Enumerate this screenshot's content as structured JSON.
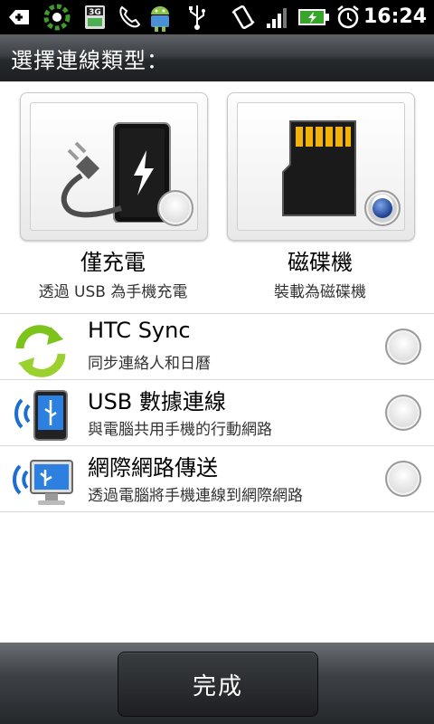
{
  "status_bar": {
    "time": "16:24",
    "network_type": "3G",
    "icons": [
      "add-icon",
      "loading-icon",
      "sim-3g-icon",
      "phone-icon",
      "android-icon",
      "usb-icon",
      "vibrate-icon",
      "signal-icon",
      "battery-charging-icon",
      "alarm-icon"
    ]
  },
  "title": "選擇連線類型：",
  "options": [
    {
      "label": "僅充電",
      "description": "透過 USB 為手機充電",
      "icon": "charger-phone-icon",
      "selected": false
    },
    {
      "label": "磁碟機",
      "description": "裝載為磁碟機",
      "icon": "sd-card-icon",
      "selected": true
    }
  ],
  "list": [
    {
      "title": "HTC Sync",
      "subtitle": "同步連絡人和日曆",
      "icon": "sync-icon",
      "selected": false
    },
    {
      "title": "USB 數據連線",
      "subtitle": "與電腦共用手機的行動網路",
      "icon": "usb-tethering-icon",
      "selected": false
    },
    {
      "title": "網際網路傳送",
      "subtitle": "透過電腦將手機連線到網際網路",
      "icon": "internet-passthrough-icon",
      "selected": false
    }
  ],
  "done_button": "完成",
  "colors": {
    "accent": "#1b3f8f",
    "sync_green": "#7cc41c",
    "usb_blue": "#1a6fd1"
  }
}
